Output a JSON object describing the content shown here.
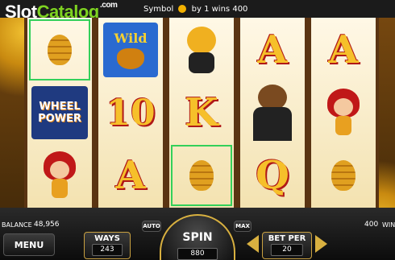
{
  "brand": {
    "part1": "Slot",
    "part2": "Catalog",
    "suffix": ".com"
  },
  "win_line": {
    "prefix": "Symbol",
    "middle": "by 1 wins",
    "amount": "400"
  },
  "reels": [
    [
      {
        "type": "hive",
        "win": true
      },
      {
        "type": "wheel",
        "line1": "WHEEL",
        "line2": "POWER"
      },
      {
        "type": "girl"
      }
    ],
    [
      {
        "type": "wild",
        "text": "Wild"
      },
      {
        "type": "num",
        "text": "10"
      },
      {
        "type": "letter",
        "text": "A"
      }
    ],
    [
      {
        "type": "beebear"
      },
      {
        "type": "letter",
        "text": "K"
      },
      {
        "type": "hive",
        "win": true
      }
    ],
    [
      {
        "type": "letter",
        "text": "A"
      },
      {
        "type": "bear"
      },
      {
        "type": "letter",
        "text": "Q"
      }
    ],
    [
      {
        "type": "letter",
        "text": "A"
      },
      {
        "type": "girl"
      },
      {
        "type": "hive"
      }
    ]
  ],
  "balance": {
    "label": "BALANCE",
    "value": "48,956"
  },
  "win": {
    "value": "400",
    "label": "WIN"
  },
  "buttons": {
    "menu": "MENU",
    "auto": "AUTO",
    "max": "MAX"
  },
  "ways": {
    "label": "WAYS",
    "value": "243"
  },
  "spin": {
    "label": "SPIN",
    "value": "880"
  },
  "bet": {
    "label": "BET PER",
    "value": "20"
  },
  "colors": {
    "accent": "#d8b040",
    "win_frame": "#33d05a",
    "symbol_gold": "#f6c02a"
  }
}
